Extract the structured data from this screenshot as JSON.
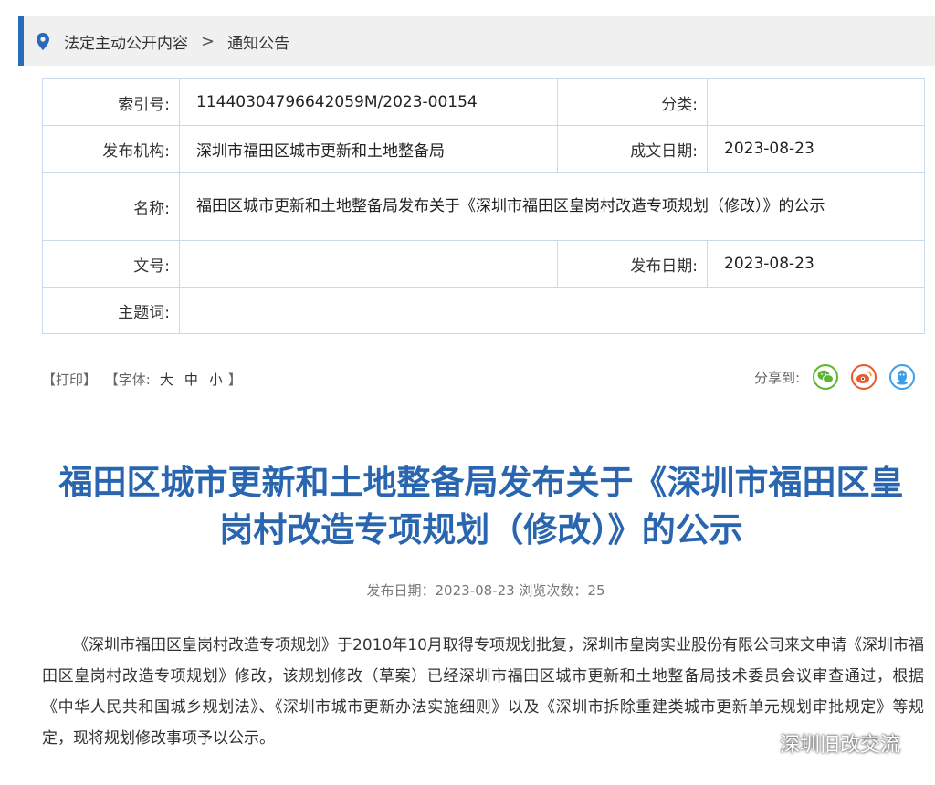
{
  "breadcrumb": {
    "item1": "法定主动公开内容",
    "separator": ">",
    "item2": "通知公告"
  },
  "meta": {
    "index_label": "索引号:",
    "index_value": "11440304796642059M/2023-00154",
    "category_label": "分类:",
    "category_value": "",
    "publisher_label": "发布机构:",
    "publisher_value": "深圳市福田区城市更新和土地整备局",
    "written_date_label": "成文日期:",
    "written_date_value": "2023-08-23",
    "name_label": "名称:",
    "name_value": "福田区城市更新和土地整备局发布关于《深圳市福田区皇岗村改造专项规划（修改）》的公示",
    "docno_label": "文号:",
    "docno_value": "",
    "pub_date_label": "发布日期:",
    "pub_date_value": "2023-08-23",
    "keywords_label": "主题词:",
    "keywords_value": ""
  },
  "tools": {
    "print": "【打印】",
    "font_prefix": "【字体:",
    "font_large": "大",
    "font_medium": "中",
    "font_small": "小",
    "font_suffix": "】"
  },
  "share": {
    "label": "分享到:",
    "icons": [
      "wechat-icon",
      "weibo-icon",
      "qq-icon"
    ]
  },
  "article": {
    "title_line1": "福田区城市更新和土地整备局发布关于《深圳市福田区皇",
    "title_line2": "岗村改造专项规划（修改）》的公示",
    "pub_info": "发布日期：2023-08-23  浏览次数：25",
    "body": "《深圳市福田区皇岗村改造专项规划》于2010年10月取得专项规划批复，深圳市皇岗实业股份有限公司来文申请《深圳市福田区皇岗村改造专项规划》修改，该规划修改（草案）已经深圳市福田区城市更新和土地整备局技术委员会议审查通过，根据《中华人民共和国城乡规划法》、《深圳市城市更新办法实施细则》以及《深圳市拆除重建类城市更新单元规划审批规定》等规定，现将规划修改事项予以公示。"
  },
  "watermark": {
    "text": "深圳旧改交流"
  },
  "colors": {
    "accent": "#2a66b0",
    "border": "#c9d9ee",
    "wechat": "#5cb531",
    "weibo": "#e8592e",
    "qq": "#3d9ee8"
  }
}
